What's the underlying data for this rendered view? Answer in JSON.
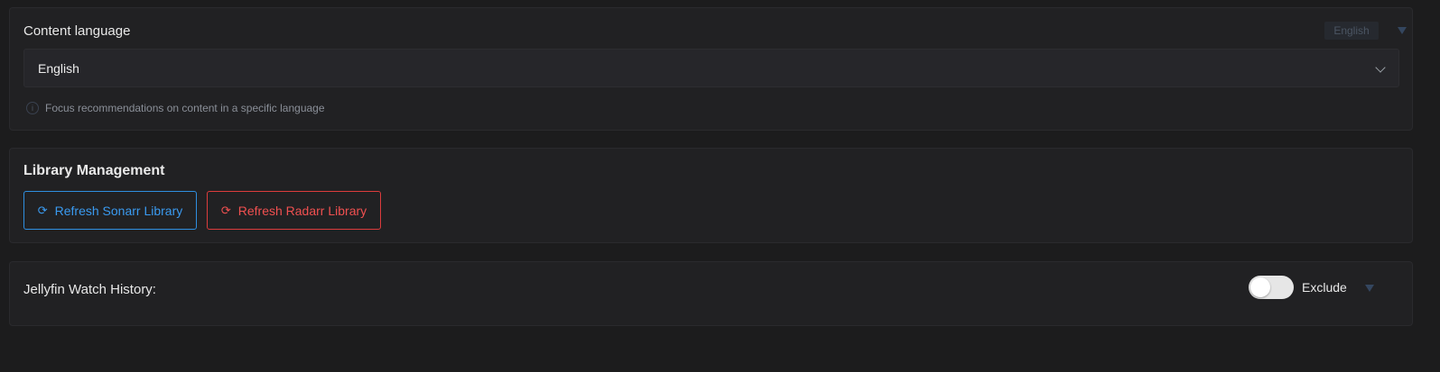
{
  "content_language": {
    "title": "Content language",
    "badge": "English",
    "selected_value": "English",
    "hint": "Focus recommendations on content in a specific language",
    "icons": {
      "info": "info-icon",
      "dropdown": "chevron-down-icon",
      "collapse": "caret-down-icon"
    }
  },
  "library_management": {
    "title": "Library Management",
    "buttons": [
      {
        "label": "Refresh Sonarr Library",
        "icon": "refresh-icon",
        "color": "#3a9af0"
      },
      {
        "label": "Refresh Radarr Library",
        "icon": "refresh-icon",
        "color": "#f05050"
      }
    ]
  },
  "jellyfin_watch_history": {
    "label": "Jellyfin Watch History:",
    "toggle_label": "Exclude",
    "toggle_on": false,
    "icons": {
      "collapse": "caret-down-icon"
    }
  },
  "colors": {
    "background": "#1c1c1d",
    "panel": "#212123",
    "accent_blue": "#3a9af0",
    "accent_red": "#f05050"
  }
}
